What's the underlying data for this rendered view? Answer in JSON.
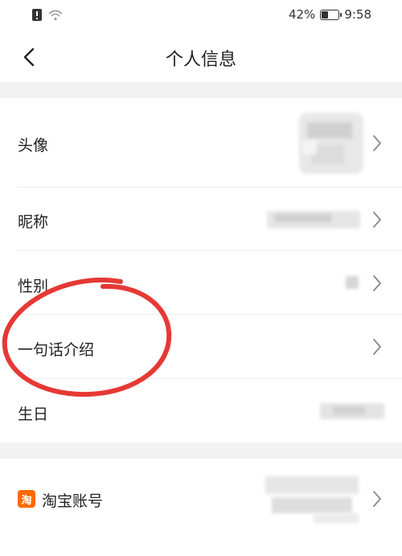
{
  "status_bar": {
    "battery_percent": "42%",
    "battery_level": 0.42,
    "time": "9:58"
  },
  "nav": {
    "title": "个人信息"
  },
  "rows": {
    "avatar": {
      "label": "头像"
    },
    "nickname": {
      "label": "昵称"
    },
    "gender": {
      "label": "性别"
    },
    "bio": {
      "label": "一句话介绍"
    },
    "birthday": {
      "label": "生日"
    },
    "taobao": {
      "label": "淘宝账号",
      "badge_text": "淘"
    }
  },
  "colors": {
    "divider_gap": "#f2f2f2",
    "annotation_circle": "#e53935",
    "taobao_orange": "#ff6a00"
  },
  "icons": {
    "back": "chevron-left-icon",
    "row_arrow": "chevron-right-icon"
  }
}
